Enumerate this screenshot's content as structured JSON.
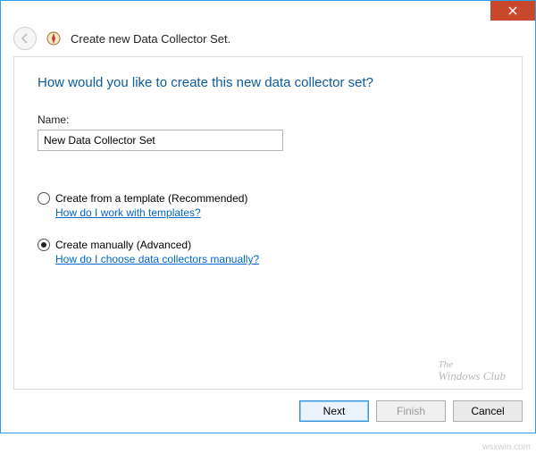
{
  "window": {
    "title": "Create new Data Collector Set."
  },
  "main": {
    "heading": "How would you like to create this new data collector set?",
    "name_label": "Name:",
    "name_value": "New Data Collector Set",
    "options": {
      "template": {
        "label": "Create from a template (Recommended)",
        "help": "How do I work with templates?",
        "selected": false
      },
      "manual": {
        "label": "Create manually (Advanced)",
        "help": "How do I choose data collectors manually?",
        "selected": true
      }
    }
  },
  "footer": {
    "next": "Next",
    "finish": "Finish",
    "cancel": "Cancel"
  },
  "watermark": {
    "line1": "The",
    "line2": "Windows Club"
  },
  "source": "wsxwin.com"
}
